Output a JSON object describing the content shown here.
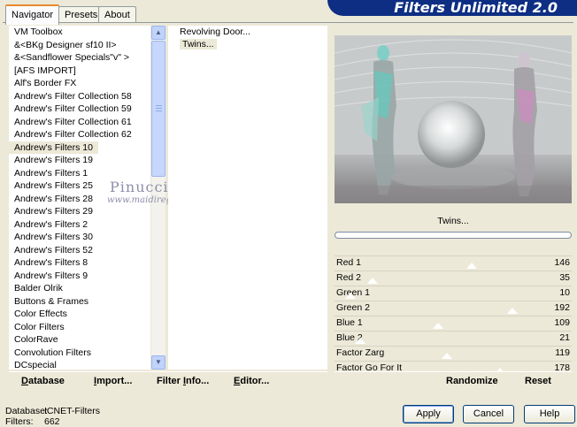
{
  "tabs": [
    {
      "label": "Navigator",
      "active": true
    },
    {
      "label": "Presets",
      "active": false
    },
    {
      "label": "About",
      "active": false
    }
  ],
  "banner": {
    "title": "Filters Unlimited 2.0"
  },
  "categories": [
    "VM Toolbox",
    "&<BKg Designer sf10 II>",
    "&<Sandflower Specials\"v\" >",
    "[AFS IMPORT]",
    "Alf's Border FX",
    "Andrew's Filter Collection 58",
    "Andrew's Filter Collection 59",
    "Andrew's Filter Collection 61",
    "Andrew's Filter Collection 62",
    "Andrew's Filters 10",
    "Andrew's Filters 19",
    "Andrew's Filters 1",
    "Andrew's Filters 25",
    "Andrew's Filters 28",
    "Andrew's Filters 29",
    "Andrew's Filters 2",
    "Andrew's Filters 30",
    "Andrew's Filters 52",
    "Andrew's Filters 8",
    "Andrew's Filters 9",
    "Balder Olrik",
    "Buttons & Frames",
    "Color Effects",
    "Color Filters",
    "ColorRave",
    "Convolution Filters",
    "DCspecial"
  ],
  "selected_category": "Andrew's Filters 10",
  "filters": [
    "Revolving Door...",
    "Twins..."
  ],
  "selected_filter": "Twins...",
  "watermark": {
    "line1": "Pinuccia",
    "line2": "www.maidiregrafica.eu"
  },
  "preview": {
    "filter_name": "Twins...",
    "progress": 0
  },
  "params": [
    {
      "label": "Red 1",
      "value": 146
    },
    {
      "label": "Red 2",
      "value": 35
    },
    {
      "label": "Green 1",
      "value": 10
    },
    {
      "label": "Green 2",
      "value": 192
    },
    {
      "label": "Blue 1",
      "value": 109
    },
    {
      "label": "Blue 2",
      "value": 21
    },
    {
      "label": "Factor Zarg",
      "value": 119
    },
    {
      "label": "Factor Go For It",
      "value": 178
    }
  ],
  "param_max": 255,
  "toolbar_left": {
    "database": {
      "first": "D",
      "rest": "atabase"
    },
    "import": {
      "first": "I",
      "rest": "mport..."
    },
    "filter_info": {
      "pre": "Filter ",
      "first": "I",
      "rest": "nfo..."
    },
    "editor": {
      "first": "E",
      "rest": "ditor..."
    }
  },
  "toolbar_right": {
    "randomize": "Randomize",
    "reset": "Reset"
  },
  "status": {
    "database_label": "Database:",
    "database_value": "ICNET-Filters",
    "filters_label": "Filters:",
    "filters_value": "662"
  },
  "buttons": {
    "apply": "Apply",
    "cancel": "Cancel",
    "help": "Help"
  },
  "colors": {
    "banner": "#0d2e83",
    "tab_accent": "#e68b2c",
    "window_bg": "#ece9d8"
  }
}
